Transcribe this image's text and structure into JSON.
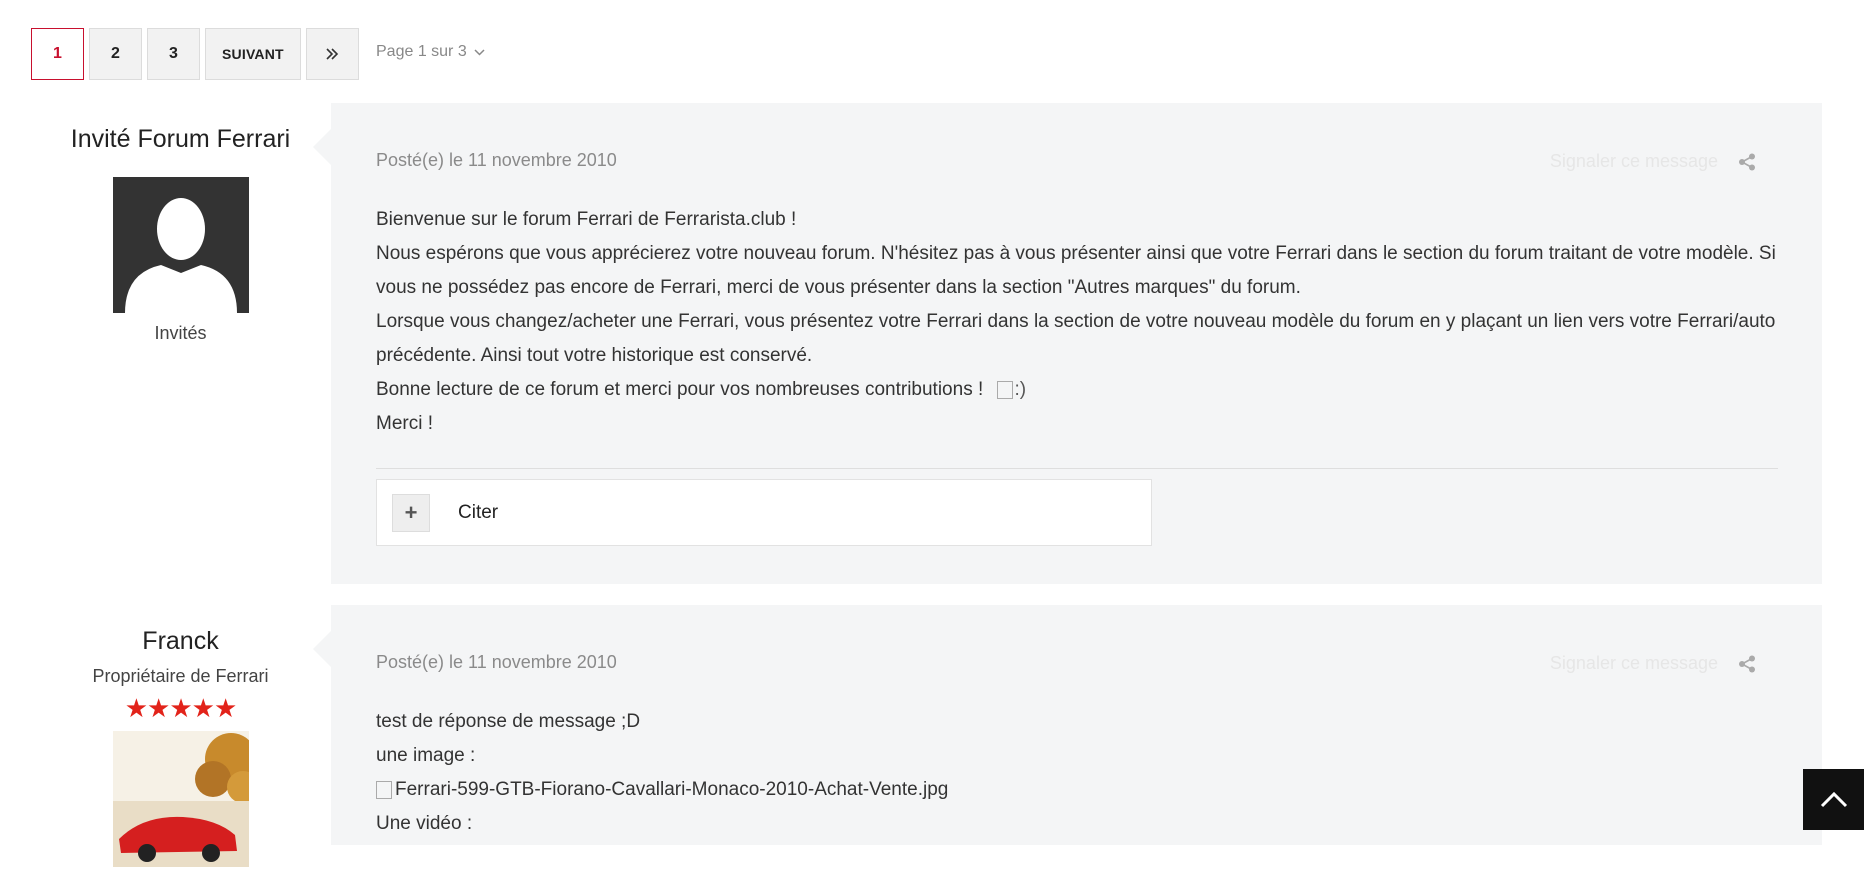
{
  "pagination": {
    "pages": [
      "1",
      "2",
      "3"
    ],
    "active": "1",
    "next_label": "SUIVANT",
    "last_label": "»",
    "page_info": "Page 1 sur 3"
  },
  "posts": [
    {
      "author": {
        "name": "Invité Forum Ferrari",
        "group": "Invités"
      },
      "date": "Posté(e) le 11 novembre 2010",
      "report_label": "Signaler ce message",
      "paragraphs": [
        "Bienvenue sur le forum Ferrari de Ferrarista.club !",
        "Nous espérons que vous apprécierez votre nouveau forum. N'hésitez pas à vous présenter ainsi que votre Ferrari dans le section du forum traitant de votre modèle. Si vous ne possédez pas encore de Ferrari, merci de vous présenter dans la section \"Autres marques\" du forum.",
        "Lorsque vous changez/acheter une Ferrari, vous présentez votre Ferrari dans la section de votre nouveau modèle du forum en y plaçant un lien vers votre Ferrari/auto précédente. Ainsi tout votre historique est conservé.",
        "Bonne lecture de ce forum et merci pour vos nombreuses contributions !",
        "Merci !"
      ],
      "smiley_alt": ":)",
      "quote_label": "Citer"
    },
    {
      "author": {
        "name": "Franck",
        "rank": "Propriétaire de Ferrari",
        "stars": 5
      },
      "date": "Posté(e) le 11 novembre 2010",
      "report_label": "Signaler ce message",
      "paragraphs": [
        "test de réponse de message  ;D",
        "une image :",
        "Ferrari-599-GTB-Fiorano-Cavallari-Monaco-2010-Achat-Vente.jpg",
        "Une vidéo :"
      ]
    }
  ],
  "colors": {
    "accent": "#c8102e",
    "bubble_bg": "#f4f5f6",
    "star": "#e2231a"
  },
  "icons": {
    "back_to_top": "chevron-up-icon",
    "share": "share-icon",
    "dropdown": "chevron-down-icon",
    "last_page": "double-chevron-right-icon"
  }
}
